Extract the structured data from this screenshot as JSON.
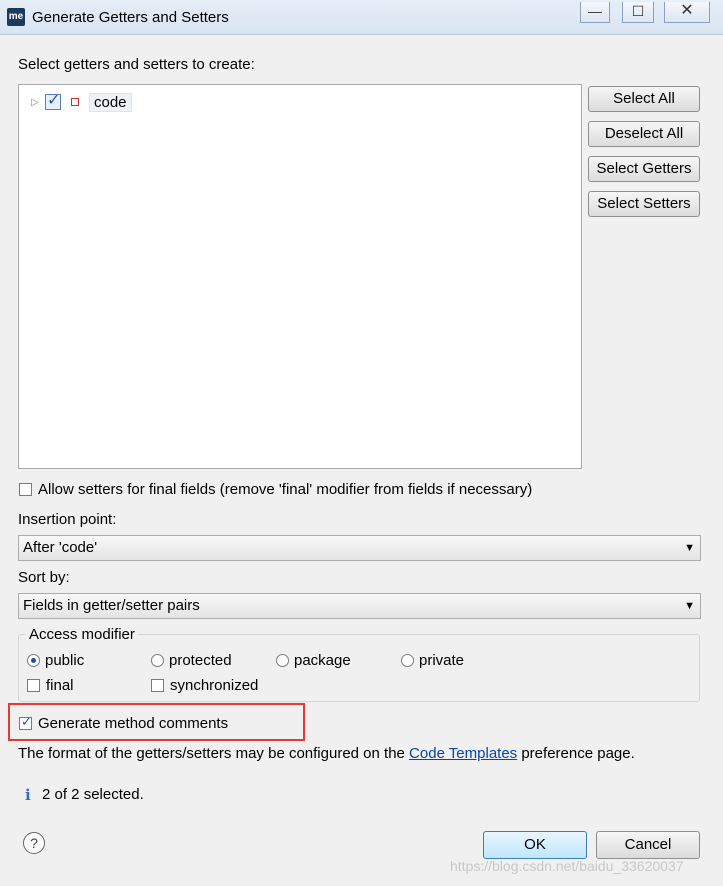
{
  "window": {
    "app_icon_text": "me",
    "title": "Generate Getters and Setters",
    "minimize": "—",
    "maximize": "☐",
    "close": "✕"
  },
  "tree_section": {
    "label": "Select getters and setters to create:",
    "items": [
      {
        "label": "code",
        "checked": true,
        "expanded": false
      }
    ]
  },
  "side_buttons": {
    "select_all": "Select All",
    "deselect_all": "Deselect All",
    "select_getters": "Select Getters",
    "select_setters": "Select Setters"
  },
  "allow_setters_final": {
    "label": "Allow setters for final fields (remove 'final' modifier from fields if necessary)",
    "checked": false
  },
  "insertion_point": {
    "label": "Insertion point:",
    "value": "After 'code'"
  },
  "sort_by": {
    "label": "Sort by:",
    "value": "Fields in getter/setter pairs"
  },
  "access_modifier": {
    "title": "Access modifier",
    "options": [
      "public",
      "protected",
      "package",
      "private"
    ],
    "selected": "public",
    "final_label": "final",
    "synchronized_label": "synchronized"
  },
  "generate_comments": {
    "label": "Generate method comments",
    "checked": true
  },
  "format_note": {
    "prefix": "The format of the getters/setters may be configured on the",
    "link": "Code Templates",
    "suffix": "preference page."
  },
  "status": {
    "icon": "i",
    "text": "2 of 2 selected."
  },
  "footer": {
    "help": "?",
    "ok": "OK",
    "cancel": "Cancel"
  },
  "watermark": "https://blog.csdn.net/baidu_33620037",
  "colors": {
    "highlight_box": "#e53935",
    "link": "#0645ad"
  }
}
